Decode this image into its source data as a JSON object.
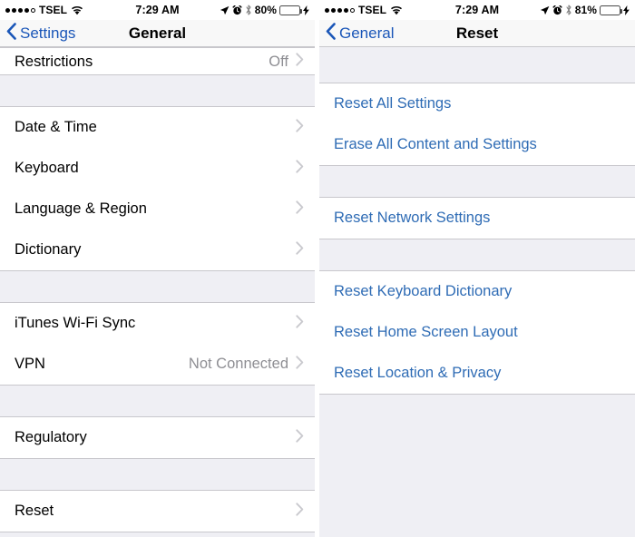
{
  "screens": [
    {
      "id": "general",
      "statusbar": {
        "signal_filled": 4,
        "signal_total": 5,
        "carrier": "TSEL",
        "wifi_icon": "wifi-icon",
        "time": "7:29 AM",
        "location_icon": "location-arrow-icon",
        "alarm_icon": "alarm-clock-icon",
        "bluetooth_icon": "bluetooth-icon",
        "battery_percent": "80%",
        "battery_level": 80,
        "battery_color": "#ffcc00",
        "charging_icon": "lightning-bolt-icon"
      },
      "navbar": {
        "back_label": "Settings",
        "back_icon": "chevron-left-icon",
        "title": "General"
      },
      "groups": [
        {
          "partial": true,
          "rows": [
            {
              "label": "Restrictions",
              "value": "Off",
              "chevron": "chevron-right-icon"
            }
          ]
        },
        {
          "rows": [
            {
              "label": "Date & Time",
              "value": "",
              "chevron": "chevron-right-icon"
            },
            {
              "label": "Keyboard",
              "value": "",
              "chevron": "chevron-right-icon"
            },
            {
              "label": "Language & Region",
              "value": "",
              "chevron": "chevron-right-icon"
            },
            {
              "label": "Dictionary",
              "value": "",
              "chevron": "chevron-right-icon"
            }
          ]
        },
        {
          "rows": [
            {
              "label": "iTunes Wi-Fi Sync",
              "value": "",
              "chevron": "chevron-right-icon"
            },
            {
              "label": "VPN",
              "value": "Not Connected",
              "chevron": "chevron-right-icon"
            }
          ]
        },
        {
          "rows": [
            {
              "label": "Regulatory",
              "value": "",
              "chevron": "chevron-right-icon"
            }
          ]
        },
        {
          "rows": [
            {
              "label": "Reset",
              "value": "",
              "chevron": "chevron-right-icon"
            }
          ]
        }
      ]
    },
    {
      "id": "reset",
      "statusbar": {
        "signal_filled": 4,
        "signal_total": 5,
        "carrier": "TSEL",
        "wifi_icon": "wifi-icon",
        "time": "7:29 AM",
        "location_icon": "location-arrow-icon",
        "alarm_icon": "alarm-clock-icon",
        "bluetooth_icon": "bluetooth-icon",
        "battery_percent": "81%",
        "battery_level": 81,
        "battery_color": "#ffcc00",
        "charging_icon": "lightning-bolt-icon"
      },
      "navbar": {
        "back_label": "General",
        "back_icon": "chevron-left-icon",
        "title": "Reset"
      },
      "groups": [
        {
          "rows": [
            {
              "label": "Reset All Settings",
              "link": true
            },
            {
              "label": "Erase All Content and Settings",
              "link": true
            }
          ]
        },
        {
          "rows": [
            {
              "label": "Reset Network Settings",
              "link": true
            }
          ]
        },
        {
          "rows": [
            {
              "label": "Reset Keyboard Dictionary",
              "link": true
            },
            {
              "label": "Reset Home Screen Layout",
              "link": true
            },
            {
              "label": "Reset Location & Privacy",
              "link": true
            }
          ]
        }
      ]
    }
  ],
  "colors": {
    "link_blue": "#2f6cb5",
    "nav_blue": "#1a56b8",
    "group_bg": "#efeff4",
    "row_bg": "#ffffff",
    "separator": "#d3d3d8",
    "secondary_text": "#8e8e93"
  }
}
